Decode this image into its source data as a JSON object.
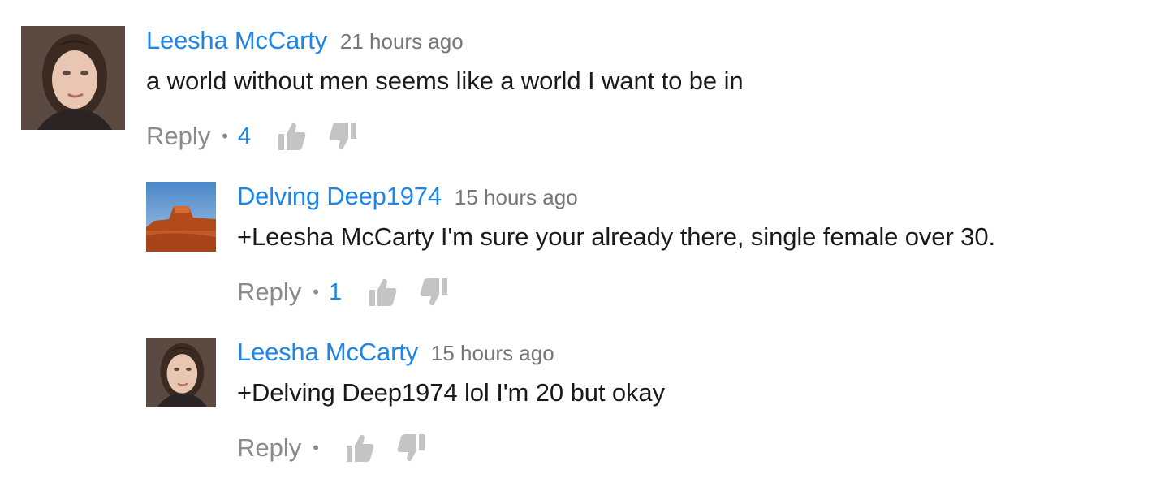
{
  "comments": [
    {
      "author": "Leesha McCarty",
      "time": "21 hours ago",
      "text": "a world without men seems like a world I want to be in",
      "reply_label": "Reply",
      "separator": "•",
      "likes": "4",
      "avatar": "woman-portrait-avatar"
    },
    {
      "author": "Delving Deep1974",
      "time": "15 hours ago",
      "text": "+Leesha McCarty I'm sure your already there, single female over 30.",
      "reply_label": "Reply",
      "separator": "•",
      "likes": "1",
      "avatar": "desert-landscape-avatar"
    },
    {
      "author": "Leesha McCarty",
      "time": "15 hours ago",
      "text": "+Delving Deep1974 lol I'm 20 but okay",
      "reply_label": "Reply",
      "separator": "•",
      "likes": "",
      "avatar": "woman-portrait-avatar"
    }
  ],
  "colors": {
    "author": "#1f86e8",
    "likes": "#1f86e8",
    "time": "#767676",
    "reply": "#8a8a8a",
    "thumb": "#c4c4c4"
  }
}
